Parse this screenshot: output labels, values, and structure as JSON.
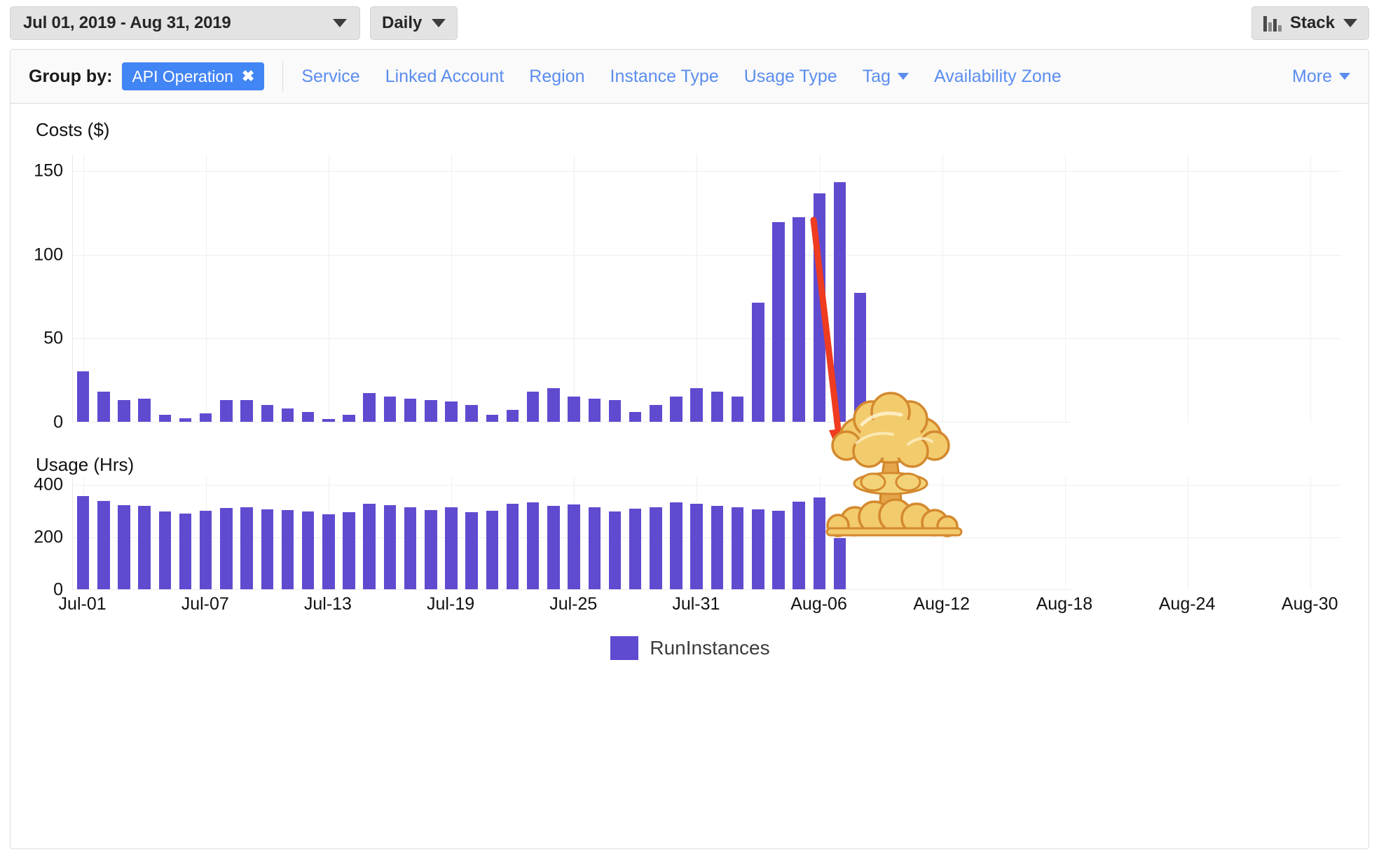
{
  "toolbar": {
    "date_range": "Jul 01, 2019 - Aug 31, 2019",
    "granularity": "Daily",
    "stack_label": "Stack",
    "stack_icon": "bar-chart-icon",
    "caret_icon": "chevron-down-icon"
  },
  "group_by": {
    "label": "Group by:",
    "active_chip": "API Operation",
    "chip_close_icon": "close-icon",
    "options": [
      {
        "label": "Service",
        "has_caret": false
      },
      {
        "label": "Linked Account",
        "has_caret": false
      },
      {
        "label": "Region",
        "has_caret": false
      },
      {
        "label": "Instance Type",
        "has_caret": false
      },
      {
        "label": "Usage Type",
        "has_caret": false
      },
      {
        "label": "Tag",
        "has_caret": true
      },
      {
        "label": "Availability Zone",
        "has_caret": false
      }
    ],
    "more_label": "More",
    "more_has_caret": true
  },
  "legend": {
    "series_name": "RunInstances",
    "swatch_color": "#5f4bd0"
  },
  "annotation": {
    "arrow_color": "#ef3b1f",
    "arrow_icon": "down-arrow-annotation",
    "explosion_icon": "mushroom-cloud-icon",
    "explosion_color": "#f2cf72",
    "explosion_outline": "#d4892e"
  },
  "chart_data": [
    {
      "id": "costs",
      "type": "bar",
      "title": "Costs ($)",
      "xlabel": "",
      "ylabel": "Costs ($)",
      "ylim": [
        0,
        160
      ],
      "yticks": [
        0,
        50,
        100,
        150
      ],
      "grid": true,
      "legend_position": "bottom",
      "series_name": "RunInstances",
      "color": "#5f4bd0",
      "x": [
        "Jul-01",
        "Jul-02",
        "Jul-03",
        "Jul-04",
        "Jul-05",
        "Jul-06",
        "Jul-07",
        "Jul-08",
        "Jul-09",
        "Jul-10",
        "Jul-11",
        "Jul-12",
        "Jul-13",
        "Jul-14",
        "Jul-15",
        "Jul-16",
        "Jul-17",
        "Jul-18",
        "Jul-19",
        "Jul-20",
        "Jul-21",
        "Jul-22",
        "Jul-23",
        "Jul-24",
        "Jul-25",
        "Jul-26",
        "Jul-27",
        "Jul-28",
        "Jul-29",
        "Jul-30",
        "Jul-31",
        "Aug-01",
        "Aug-02",
        "Aug-03",
        "Aug-04",
        "Aug-05",
        "Aug-06",
        "Aug-07",
        "Aug-08",
        "Aug-09",
        "Aug-10",
        "Aug-11",
        "Aug-12",
        "Aug-13",
        "Aug-14",
        "Aug-15",
        "Aug-16",
        "Aug-17",
        "Aug-18",
        "Aug-19",
        "Aug-20",
        "Aug-21",
        "Aug-22",
        "Aug-23",
        "Aug-24",
        "Aug-25",
        "Aug-26",
        "Aug-27",
        "Aug-28",
        "Aug-29",
        "Aug-30",
        "Aug-31"
      ],
      "values": [
        30,
        18,
        13,
        14,
        4,
        2,
        5,
        13,
        13,
        10,
        8,
        6,
        1.5,
        4,
        17,
        15,
        14,
        13,
        12,
        10,
        4,
        7,
        18,
        20,
        15,
        14,
        13,
        6,
        10,
        15,
        20,
        18,
        15,
        71,
        119,
        122,
        136,
        143,
        77,
        0,
        0,
        0,
        0,
        0,
        0,
        0,
        0,
        0,
        0,
        0,
        0,
        0,
        0,
        0,
        0,
        0,
        0,
        0,
        0,
        0,
        0,
        0
      ]
    },
    {
      "id": "usage",
      "type": "bar",
      "title": "Usage (Hrs)",
      "xlabel": "",
      "ylabel": "Usage (Hrs)",
      "ylim": [
        0,
        430
      ],
      "yticks": [
        0,
        200,
        400
      ],
      "grid": true,
      "legend_position": "bottom",
      "series_name": "RunInstances",
      "color": "#5f4bd0",
      "x": [
        "Jul-01",
        "Jul-02",
        "Jul-03",
        "Jul-04",
        "Jul-05",
        "Jul-06",
        "Jul-07",
        "Jul-08",
        "Jul-09",
        "Jul-10",
        "Jul-11",
        "Jul-12",
        "Jul-13",
        "Jul-14",
        "Jul-15",
        "Jul-16",
        "Jul-17",
        "Jul-18",
        "Jul-19",
        "Jul-20",
        "Jul-21",
        "Jul-22",
        "Jul-23",
        "Jul-24",
        "Jul-25",
        "Jul-26",
        "Jul-27",
        "Jul-28",
        "Jul-29",
        "Jul-30",
        "Jul-31",
        "Aug-01",
        "Aug-02",
        "Aug-03",
        "Aug-04",
        "Aug-05",
        "Aug-06",
        "Aug-07",
        "Aug-08",
        "Aug-09",
        "Aug-10",
        "Aug-11",
        "Aug-12",
        "Aug-13",
        "Aug-14",
        "Aug-15",
        "Aug-16",
        "Aug-17",
        "Aug-18",
        "Aug-19",
        "Aug-20",
        "Aug-21",
        "Aug-22",
        "Aug-23",
        "Aug-24",
        "Aug-25",
        "Aug-26",
        "Aug-27",
        "Aug-28",
        "Aug-29",
        "Aug-30",
        "Aug-31"
      ],
      "values": [
        355,
        337,
        320,
        317,
        296,
        289,
        299,
        310,
        313,
        305,
        301,
        297,
        287,
        295,
        325,
        320,
        313,
        302,
        312,
        293,
        300,
        325,
        330,
        318,
        323,
        312,
        297,
        307,
        313,
        330,
        325,
        318,
        312,
        305,
        300,
        333,
        350,
        195,
        0,
        0,
        0,
        0,
        0,
        0,
        0,
        0,
        0,
        0,
        0,
        0,
        0,
        0,
        0,
        0,
        0,
        0,
        0,
        0,
        0,
        0,
        0,
        0
      ]
    }
  ],
  "xaxis": {
    "ticks": [
      "Jul-01",
      "Jul-07",
      "Jul-13",
      "Jul-19",
      "Jul-25",
      "Jul-31",
      "Aug-06",
      "Aug-12",
      "Aug-18",
      "Aug-24",
      "Aug-30"
    ],
    "tick_indices": [
      0,
      6,
      12,
      18,
      24,
      30,
      36,
      42,
      48,
      54,
      60
    ]
  }
}
